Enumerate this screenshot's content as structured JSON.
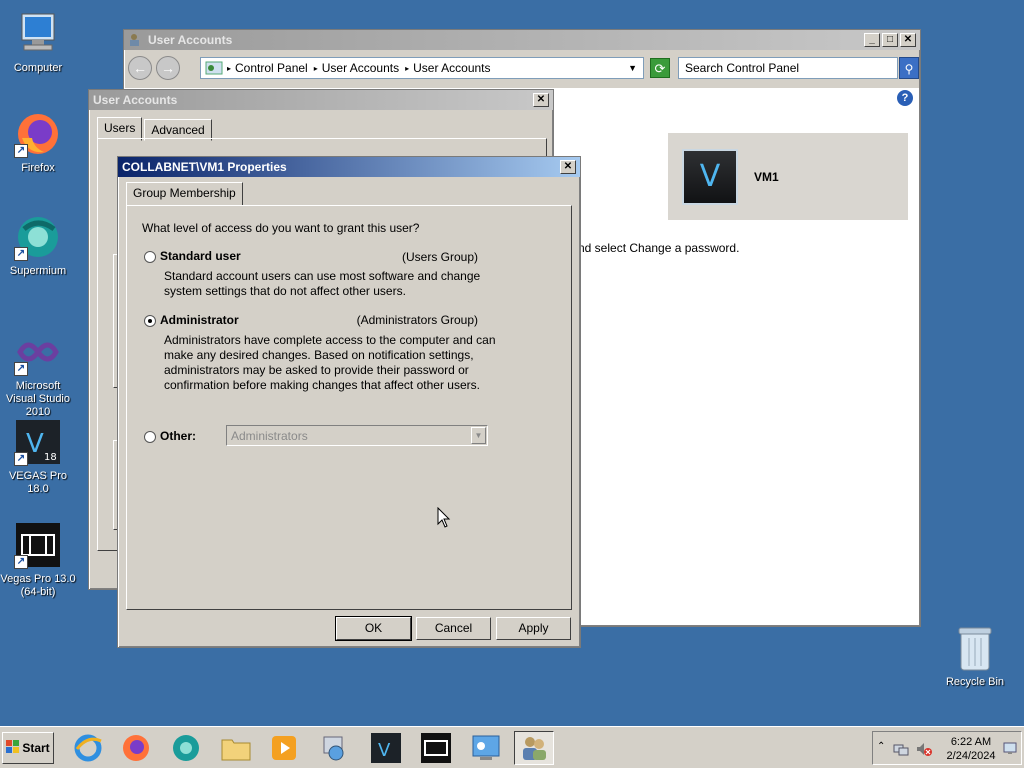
{
  "desktop": {
    "icons": [
      {
        "label": "Computer"
      },
      {
        "label": "Firefox"
      },
      {
        "label": "Supermium"
      },
      {
        "label": "Microsoft Visual Studio 2010"
      },
      {
        "label": "VEGAS Pro 18.0"
      },
      {
        "label": "Vegas Pro 13.0 (64-bit)"
      }
    ],
    "recycle_bin": "Recycle Bin"
  },
  "control_panel": {
    "title": "User Accounts",
    "breadcrumb": [
      "Control Panel",
      "User Accounts",
      "User Accounts"
    ],
    "search_placeholder": "Search Control Panel",
    "user_name": "VM1",
    "password_hint": "nd select Change a password."
  },
  "user_accounts_dialog": {
    "title": "User Accounts",
    "tabs": [
      "Users",
      "Advanced"
    ]
  },
  "properties_dialog": {
    "title": "COLLABNET\\VM1 Properties",
    "tab": "Group Membership",
    "question": "What level of access do you want to grant this user?",
    "options": [
      {
        "label": "Standard user",
        "group": "(Users Group)",
        "selected": false,
        "description": "Standard account users can use most software and change system settings that do not affect other users."
      },
      {
        "label": "Administrator",
        "group": "(Administrators Group)",
        "selected": true,
        "description": "Administrators have complete access to the computer and can make any desired changes. Based on notification settings, administrators may be asked to provide their password or confirmation before making changes that affect other users."
      },
      {
        "label": "Other:",
        "selected": false
      }
    ],
    "other_value": "Administrators",
    "buttons": {
      "ok": "OK",
      "cancel": "Cancel",
      "apply": "Apply"
    }
  },
  "taskbar": {
    "start": "Start",
    "time": "6:22 AM",
    "date": "2/24/2024"
  }
}
